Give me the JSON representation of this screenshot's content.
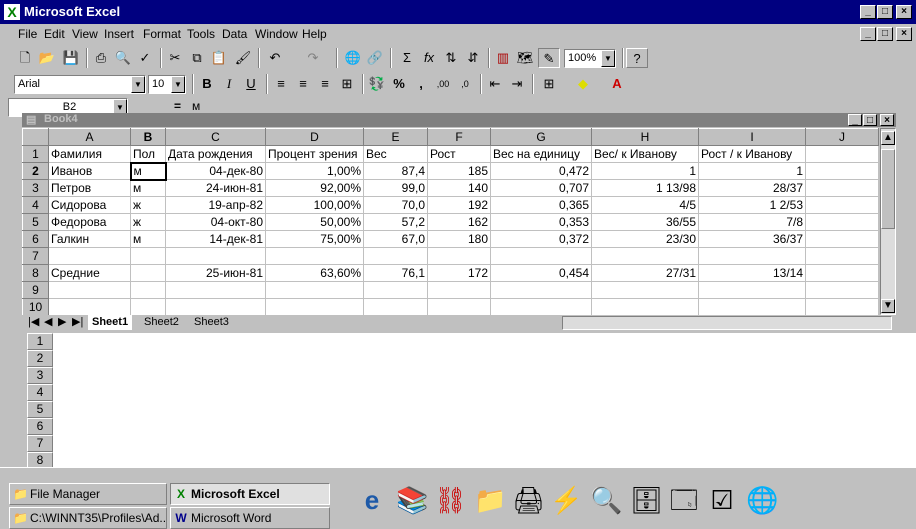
{
  "window": {
    "title": "Microsoft Excel",
    "app_icon": "excel-icon"
  },
  "menu": [
    "File",
    "Edit",
    "View",
    "Insert",
    "Format",
    "Tools",
    "Data",
    "Window",
    "Help"
  ],
  "toolbar": {
    "zoom": "100%",
    "font_name": "Arial",
    "font_size": "10"
  },
  "formula_bar": {
    "name_box": "B2",
    "equals": "=",
    "content": "м"
  },
  "workbook": {
    "title": "Book4",
    "columns": [
      "A",
      "B",
      "C",
      "D",
      "E",
      "F",
      "G",
      "H",
      "I",
      "J"
    ],
    "row_numbers": [
      "1",
      "2",
      "3",
      "4",
      "5",
      "6",
      "7",
      "8",
      "9",
      "10"
    ],
    "rows": [
      [
        "Фамилия",
        "Пол",
        "Дата рождения",
        "Процент зрения",
        "Вес",
        "Рост",
        "Вес на единицу",
        "Вес/ к Иванову",
        "Рост / к Иванову",
        ""
      ],
      [
        "Иванов",
        "м",
        "04-дек-80",
        "1,00%",
        "87,4",
        "185",
        "0,472",
        "1",
        "1",
        ""
      ],
      [
        "Петров",
        "м",
        "24-июн-81",
        "92,00%",
        "99,0",
        "140",
        "0,707",
        "1 13/98",
        "28/37",
        ""
      ],
      [
        "Сидорова",
        "ж",
        "19-апр-82",
        "100,00%",
        "70,0",
        "192",
        "0,365",
        "4/5",
        "1    2/53",
        ""
      ],
      [
        "Федорова",
        "ж",
        "04-окт-80",
        "50,00%",
        "57,2",
        "162",
        "0,353",
        "36/55",
        "7/8",
        ""
      ],
      [
        "Галкин",
        "м",
        "14-дек-81",
        "75,00%",
        "67,0",
        "180",
        "0,372",
        "23/30",
        "36/37",
        ""
      ],
      [
        "",
        "",
        "",
        "",
        "",
        "",
        "",
        "",
        "",
        ""
      ],
      [
        "Средние",
        "",
        "25-июн-81",
        "63,60%",
        "76,1",
        "172",
        "0,454",
        "27/31",
        "13/14",
        ""
      ],
      [
        "",
        "",
        "",
        "",
        "",
        "",
        "",
        "",
        "",
        ""
      ],
      [
        "",
        "",
        "",
        "",
        "",
        "",
        "",
        "",
        "",
        ""
      ]
    ],
    "sheets": [
      "Sheet1",
      "Sheet2",
      "Sheet3"
    ],
    "active_sheet": "Sheet1"
  },
  "lower_rows": [
    "1",
    "2",
    "3",
    "4",
    "5",
    "6",
    "7",
    "8"
  ],
  "taskbar": {
    "buttons": [
      {
        "label": "File Manager",
        "icon": "folder-icon"
      },
      {
        "label": "Microsoft Excel",
        "icon": "excel-icon"
      },
      {
        "label": "C:\\WINNT35\\Profiles\\Ad...",
        "icon": "folder-icon"
      },
      {
        "label": "Microsoft Word",
        "icon": "word-icon"
      }
    ]
  },
  "colors": {
    "title_active": "#000080",
    "face": "#c0c0c0",
    "excel_green": "#008000"
  }
}
